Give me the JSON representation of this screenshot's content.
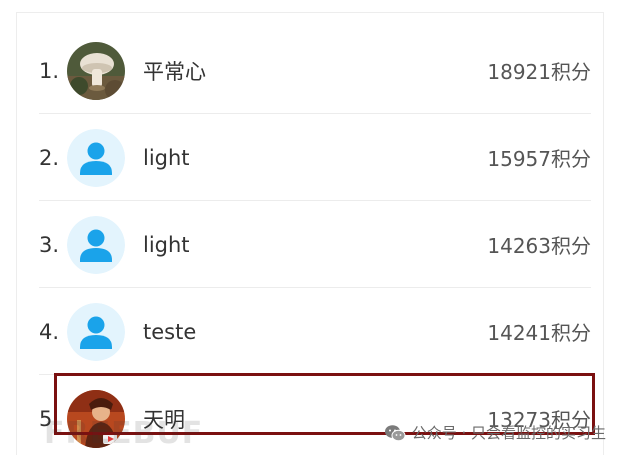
{
  "leaderboard": {
    "entries": [
      {
        "rank": "1.",
        "name": "平常心",
        "score": "18921积分",
        "avatar": "photo-avatar"
      },
      {
        "rank": "2.",
        "name": "light",
        "score": "15957积分",
        "avatar": "default-user-icon"
      },
      {
        "rank": "3.",
        "name": "light",
        "score": "14263积分",
        "avatar": "default-user-icon"
      },
      {
        "rank": "4.",
        "name": "teste",
        "score": "14241积分",
        "avatar": "default-user-icon"
      },
      {
        "rank": "5.",
        "name": "天明",
        "score": "13273积分",
        "avatar": "photo-avatar"
      }
    ],
    "highlight_color": "#7a1010"
  },
  "watermark": {
    "logo": "FREEBUF",
    "caption": "公众号 · 只会看监控的实习生",
    "icon": "wechat-icon"
  },
  "colors": {
    "avatar_bg": "#e3f4fd",
    "user_icon": "#1aa3ea"
  }
}
